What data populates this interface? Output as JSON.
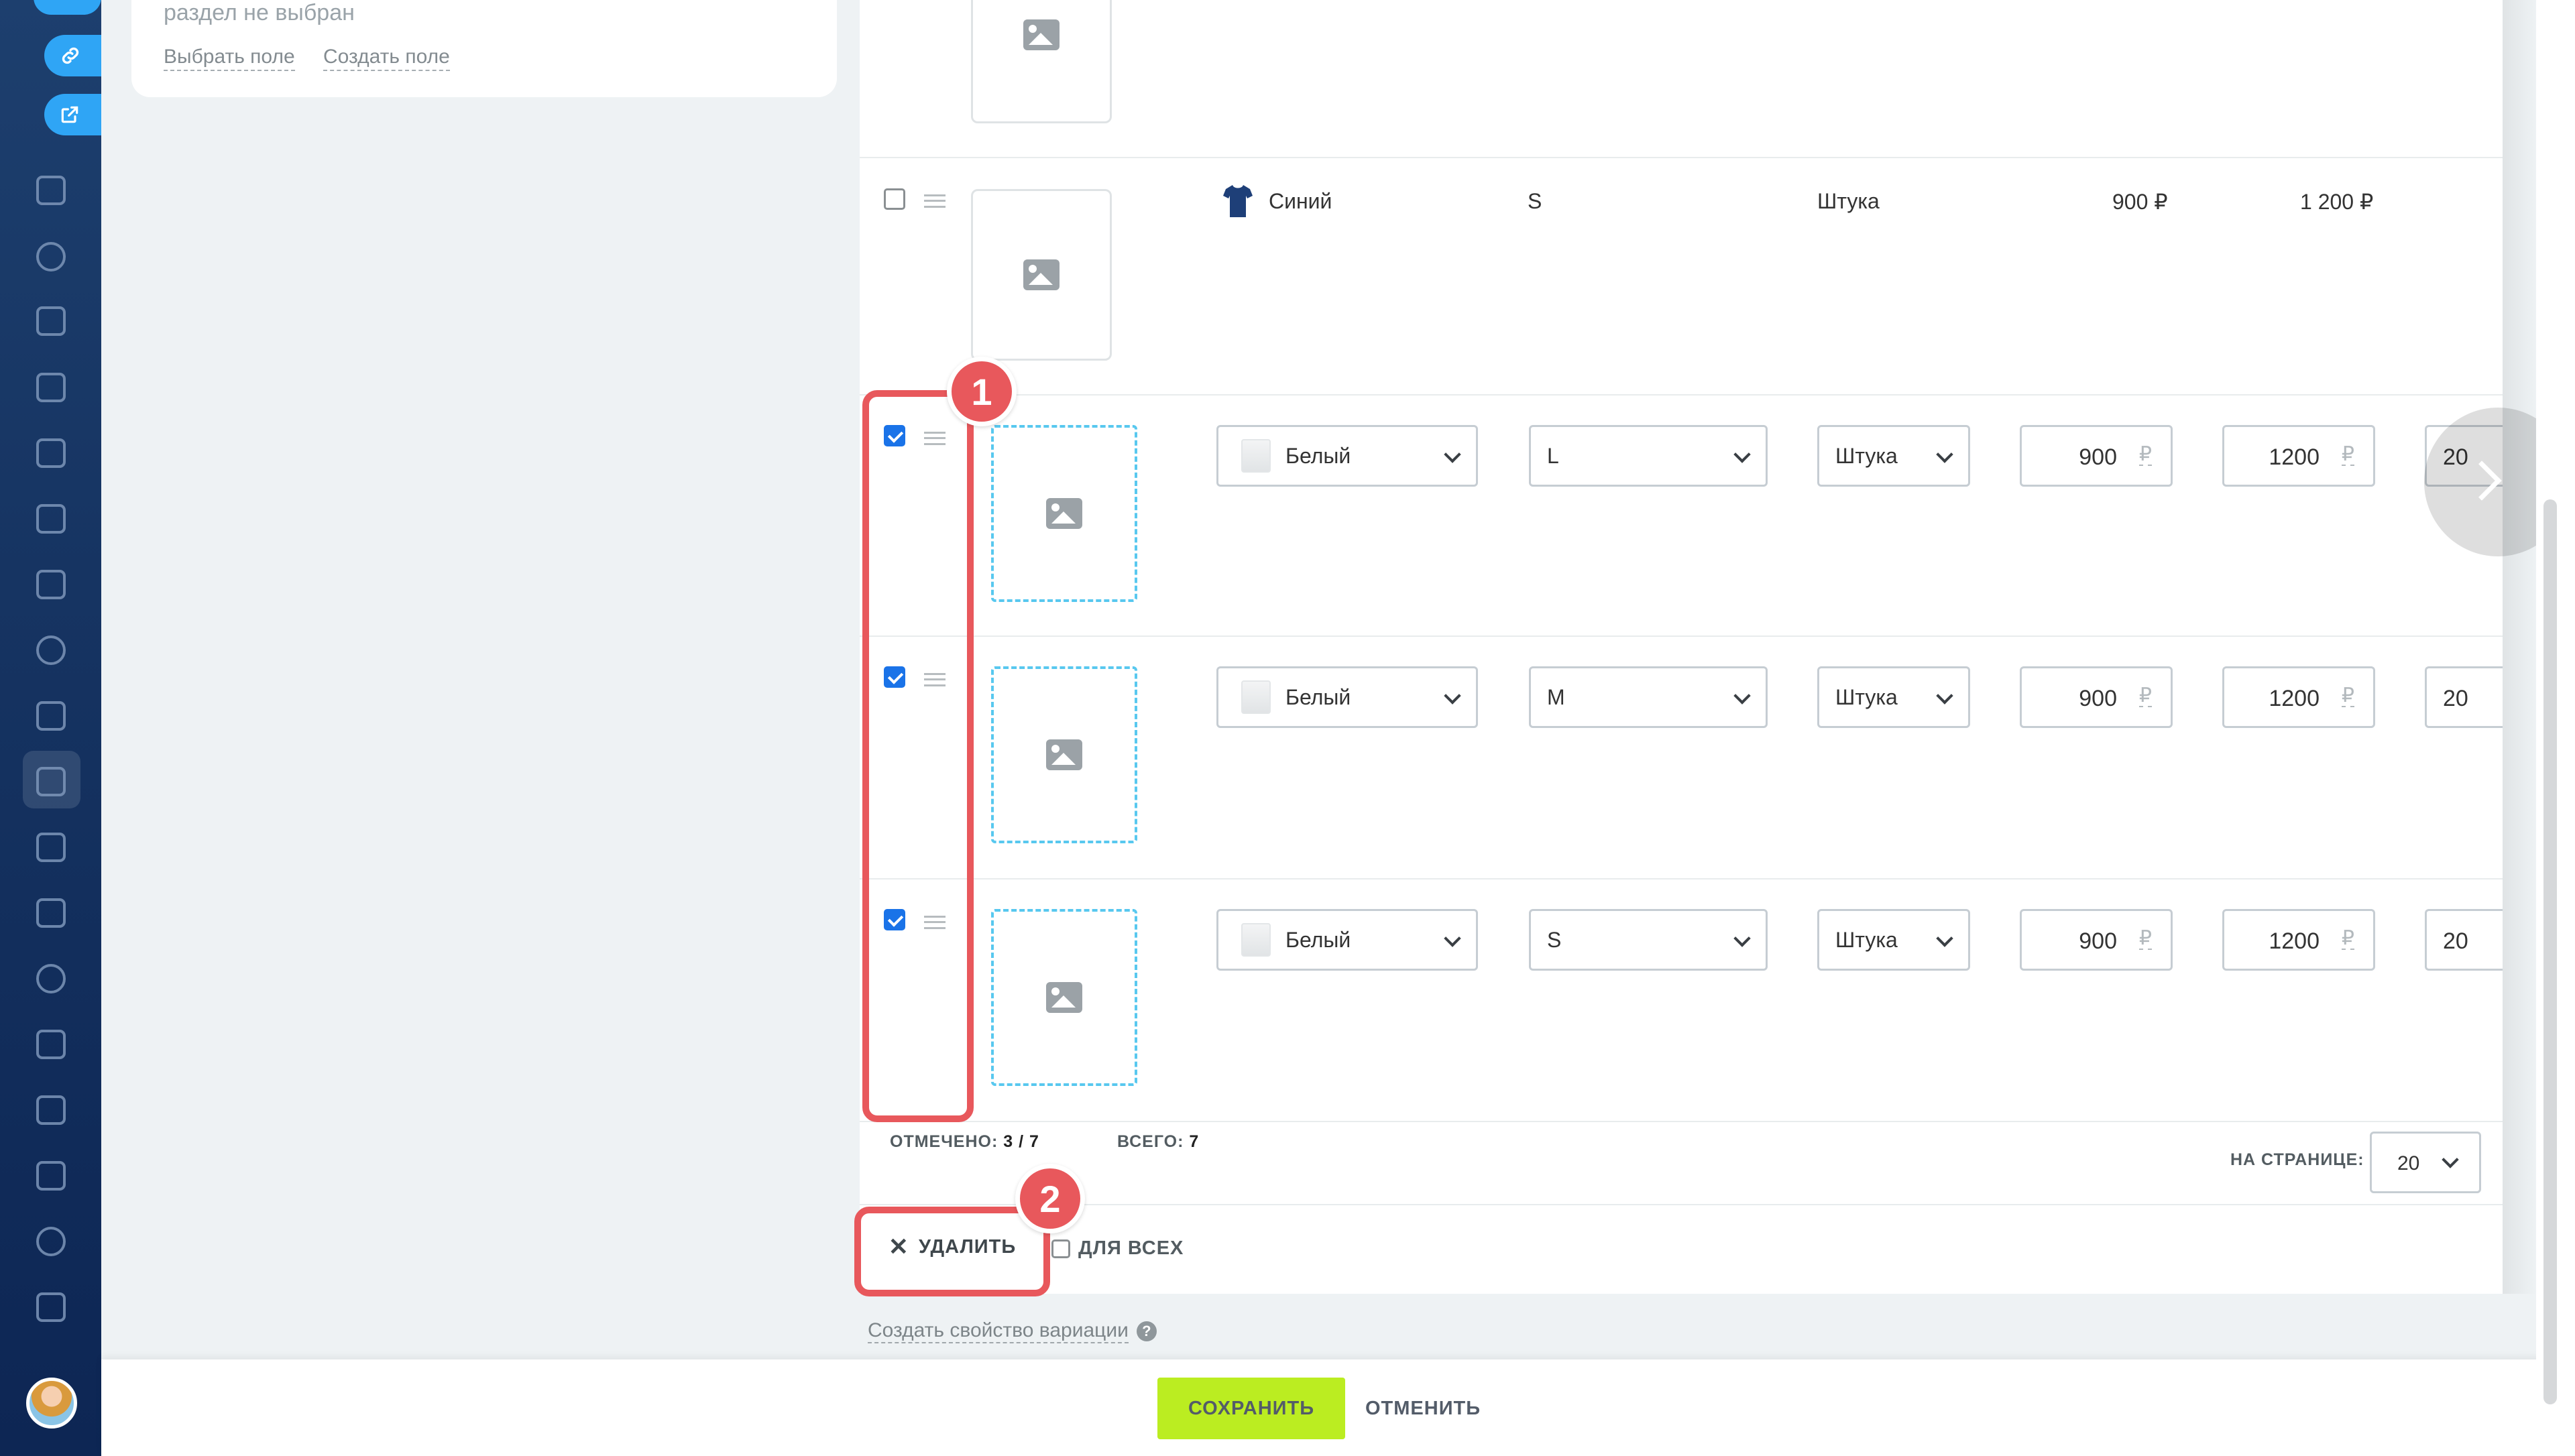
{
  "left_card": {
    "section_text": "раздел не выбран",
    "choose_field": "Выбрать поле",
    "create_field": "Создать поле"
  },
  "rows": [
    {
      "color": "Синий",
      "size": "S",
      "unit": "Штука",
      "purchase_price": "900 ₽",
      "price": "1 200 ₽",
      "checked": false,
      "editing": false
    },
    {
      "color": "Белый",
      "size": "L",
      "unit": "Штука",
      "purchase_price": "900",
      "price": "1200",
      "quantity": "20",
      "checked": true,
      "editing": true
    },
    {
      "color": "Белый",
      "size": "M",
      "unit": "Штука",
      "purchase_price": "900",
      "price": "1200",
      "quantity": "20",
      "checked": true,
      "editing": true
    },
    {
      "color": "Белый",
      "size": "S",
      "unit": "Штука",
      "purchase_price": "900",
      "price": "1200",
      "quantity": "20",
      "checked": true,
      "editing": true
    }
  ],
  "currency_symbol": "₽",
  "stats": {
    "selected_label": "ОТМЕЧЕНО:",
    "selected_value": "3 / 7",
    "total_label": "ВСЕГО:",
    "total_value": "7",
    "per_page_label": "НА СТРАНИЦЕ:",
    "per_page_value": "20"
  },
  "actions": {
    "delete_label": "УДАЛИТЬ",
    "for_all_label": "ДЛЯ ВСЕХ",
    "create_property": "Создать свойство вариации"
  },
  "bottom_bar": {
    "save_label": "СОХРАНИТЬ",
    "cancel_label": "ОТМЕНИТЬ"
  },
  "annotations": [
    {
      "number": "1"
    },
    {
      "number": "2"
    }
  ],
  "colors": {
    "accent_green": "#bbed21",
    "sidebar_blue": "#1d3f6e",
    "highlight_red": "#e8585c",
    "checkbox_blue": "#1a73e8",
    "dashed_cyan": "#58c8ef"
  },
  "icons": [
    "link-icon",
    "external-link-icon",
    "image-placeholder-icon",
    "tshirt-icon",
    "drag-handle-icon",
    "chevron-down-icon",
    "chevron-right-icon",
    "close-icon",
    "help-icon"
  ]
}
